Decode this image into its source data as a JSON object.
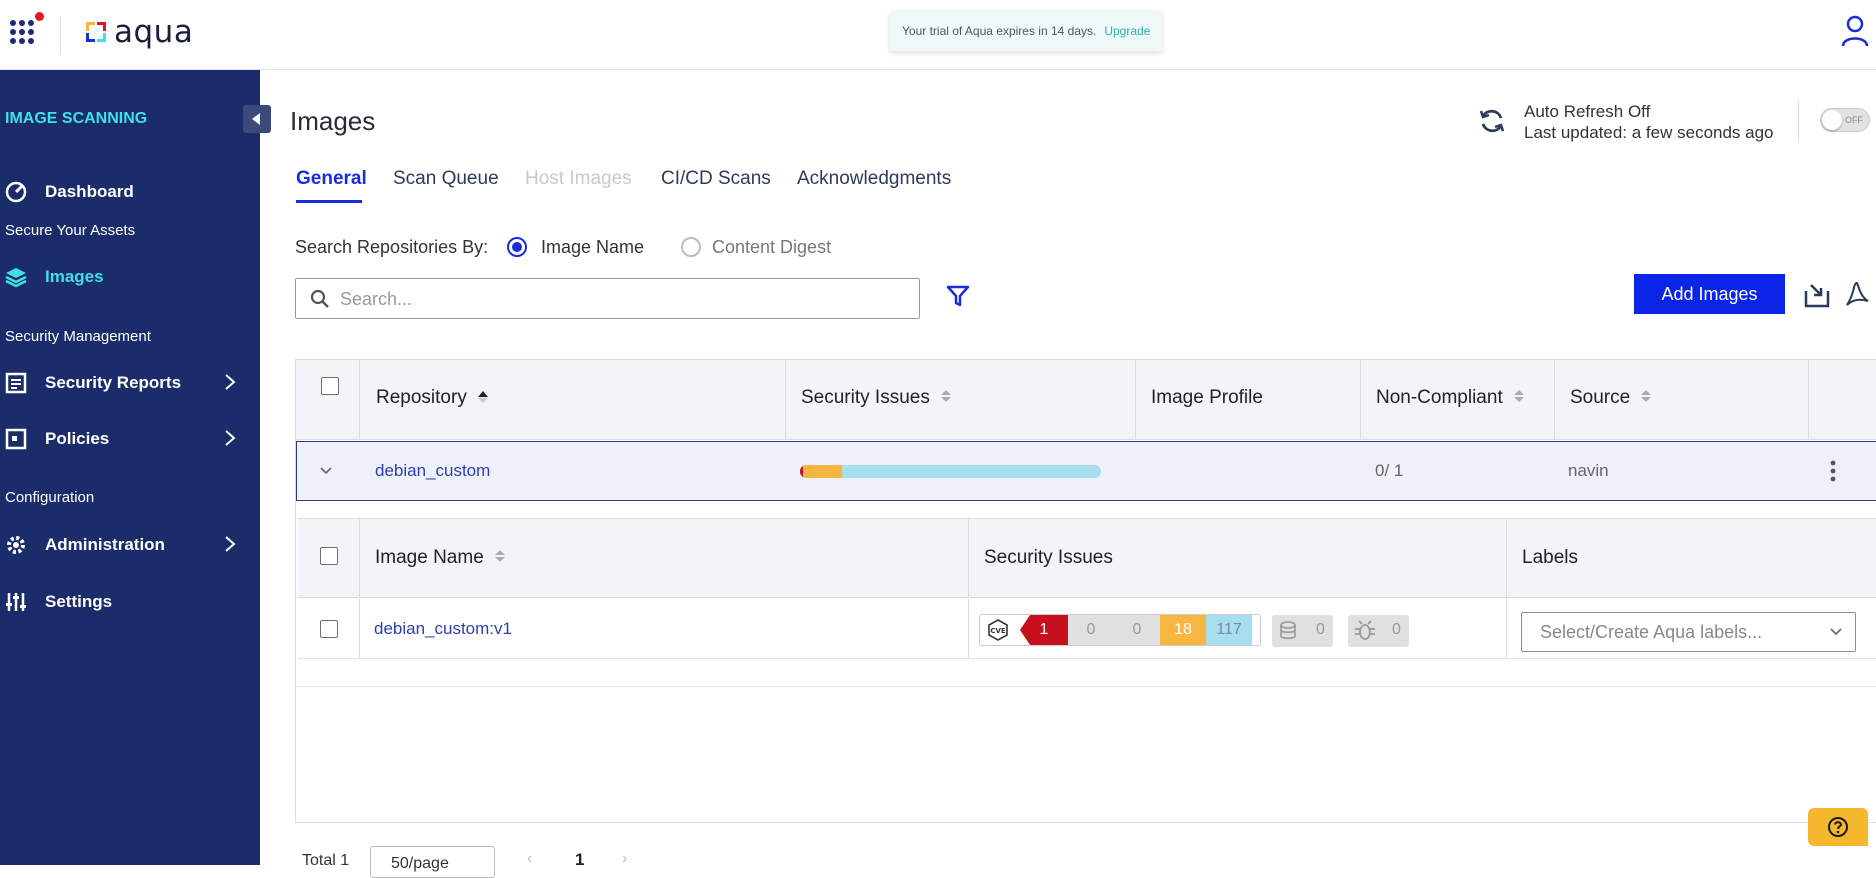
{
  "header": {
    "logo_text": "aqua",
    "trial_text": "Your trial of Aqua expires in 14 days.",
    "upgrade_link": "Upgrade"
  },
  "sidebar": {
    "section_title": "IMAGE SCANNING",
    "items": [
      {
        "label": "Dashboard",
        "icon": "gauge-icon"
      },
      {
        "group": "Secure Your Assets"
      },
      {
        "label": "Images",
        "icon": "layers-icon",
        "active": true
      },
      {
        "group": "Security Management"
      },
      {
        "label": "Security Reports",
        "icon": "report-icon"
      },
      {
        "label": "Policies",
        "icon": "policy-icon"
      },
      {
        "group": "Configuration"
      },
      {
        "label": "Administration",
        "icon": "gear-icon"
      },
      {
        "label": "Settings",
        "icon": "sliders-icon"
      }
    ]
  },
  "main": {
    "title": "Images",
    "refresh": {
      "line1": "Auto Refresh Off",
      "line2": "Last updated: a few seconds ago",
      "toggle_text": "OFF"
    },
    "tabs": [
      "General",
      "Scan Queue",
      "Host Images",
      "CI/CD Scans",
      "Acknowledgments"
    ],
    "search_by_label": "Search Repositories By:",
    "search_options": [
      "Image Name",
      "Content Digest"
    ],
    "search_placeholder": "Search...",
    "add_images_label": "Add Images"
  },
  "repo_table": {
    "columns": [
      "Repository",
      "Security Issues",
      "Image Profile",
      "Non-Compliant",
      "Source"
    ],
    "rows": [
      {
        "repository": "debian_custom",
        "image_profile": "",
        "non_compliant": "0/ 1",
        "source": "navin"
      }
    ]
  },
  "image_table": {
    "columns": [
      "Image Name",
      "Security Issues",
      "Labels"
    ],
    "rows": [
      {
        "image_name": "debian_custom:v1",
        "issues": {
          "critical": "1",
          "high": "0",
          "medium": "0",
          "low": "18",
          "negligible": "117",
          "malware": "0",
          "sensitive": "0"
        },
        "labels_placeholder": "Select/Create Aqua labels..."
      }
    ]
  },
  "pagination": {
    "total": "Total 1",
    "per_page": "50/page",
    "current_page": "1"
  },
  "colors": {
    "sidebar_bg": "#1b2c6b",
    "accent_cyan": "#3fe0e6",
    "primary_blue": "#0a25e8",
    "critical": "#c8101c",
    "low": "#f7b541",
    "negligible": "#a7dff0"
  }
}
